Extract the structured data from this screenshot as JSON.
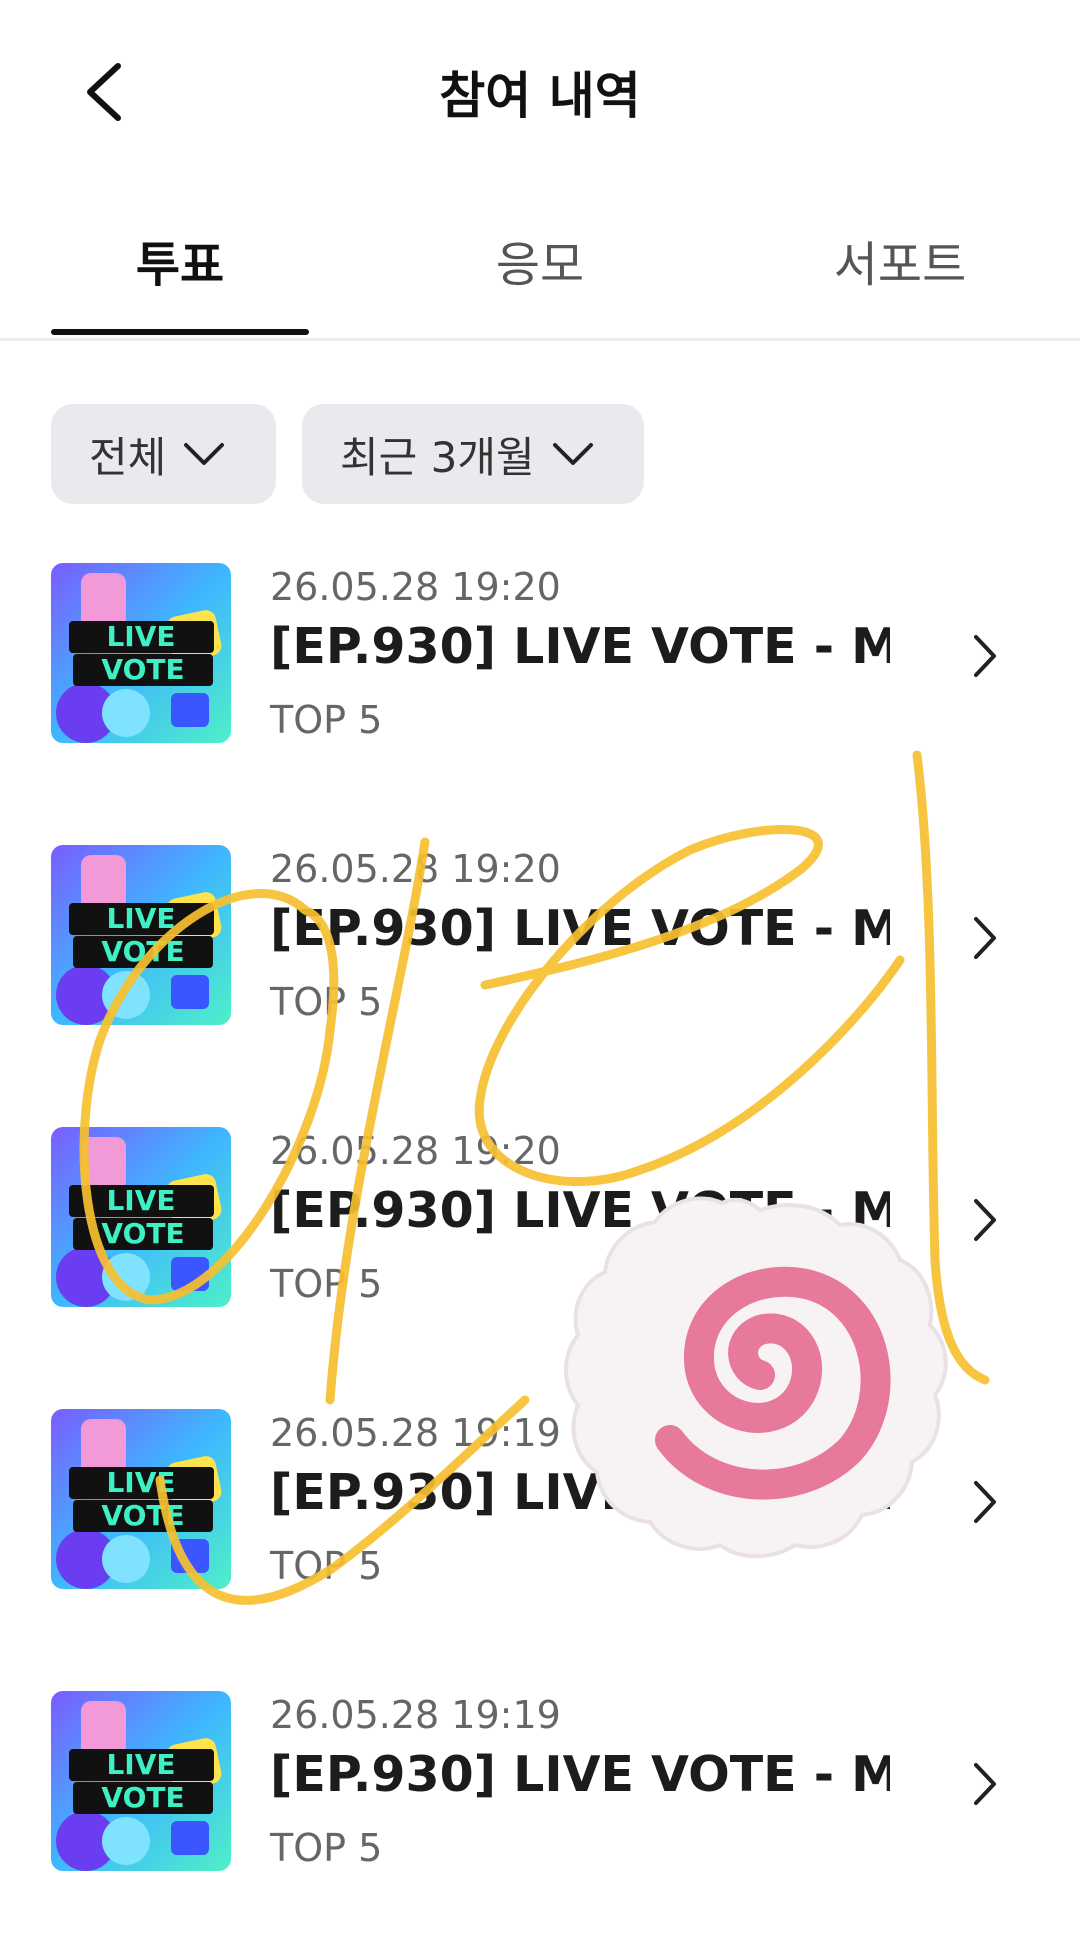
{
  "header": {
    "title": "참여 내역",
    "back_icon": "back-arrow-icon"
  },
  "tabs": [
    {
      "label": "투표",
      "active": true
    },
    {
      "label": "응모",
      "active": false
    },
    {
      "label": "서포트",
      "active": false
    }
  ],
  "filters": [
    {
      "label": "전체",
      "icon": "chevron-down-icon"
    },
    {
      "label": "최근 3개월",
      "icon": "chevron-down-icon"
    }
  ],
  "thumbnail": {
    "line1": "LIVE",
    "line2": "VOTE"
  },
  "items": [
    {
      "date": "26.05.28 19:20",
      "title": "[EP.930] LIVE VOTE - M ...",
      "subtitle": "TOP 5"
    },
    {
      "date": "26.05.28 19:20",
      "title": "[EP.930] LIVE VOTE - M ...",
      "subtitle": "TOP 5"
    },
    {
      "date": "26.05.28 19:20",
      "title": "[EP.930] LIVE VOTE - M ...",
      "subtitle": "TOP 5"
    },
    {
      "date": "26.05.28 19:19",
      "title": "[EP.930] LIVE VOTE - M ...",
      "subtitle": "TOP 5"
    },
    {
      "date": "26.05.28 19:19",
      "title": "[EP.930] LIVE VOTE - M ...",
      "subtitle": "TOP 5"
    }
  ],
  "colors": {
    "accent": "#111111",
    "filter_bg": "#e9eaee",
    "scribble": "#f7c23a",
    "sticker_pink": "#e77a9a"
  }
}
